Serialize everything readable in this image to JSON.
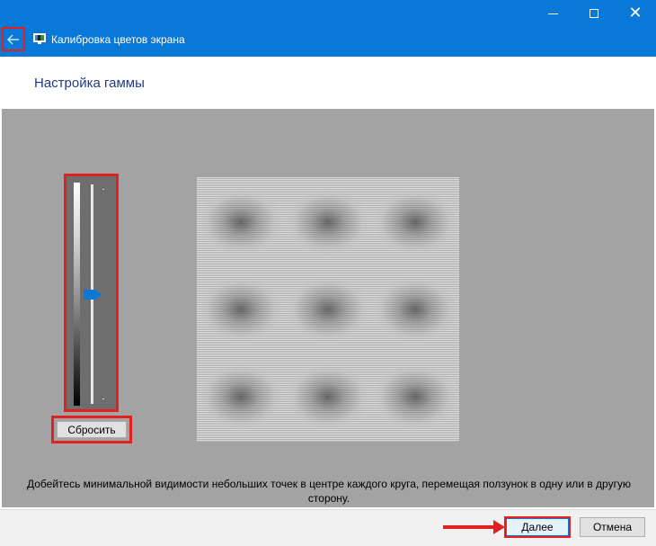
{
  "window": {
    "title": "Калибровка цветов экрана",
    "accent_color": "#0a78d7",
    "highlight_color": "#e2201e",
    "icons": {
      "back": "back-arrow-icon",
      "app": "monitor-icon",
      "minimize": "minimize-icon",
      "maximize": "maximize-icon",
      "close": "close-icon"
    }
  },
  "header": {
    "title": "Настройка гаммы"
  },
  "gamma": {
    "slider_level": 0.5,
    "reset_label": "Сбросить"
  },
  "instruction": "Добейтесь минимальной видимости небольших точек в центре каждого круга, перемещая ползунок в одну или в другую сторону.",
  "footer": {
    "next_label": "Далее",
    "cancel_label": "Отмена"
  }
}
